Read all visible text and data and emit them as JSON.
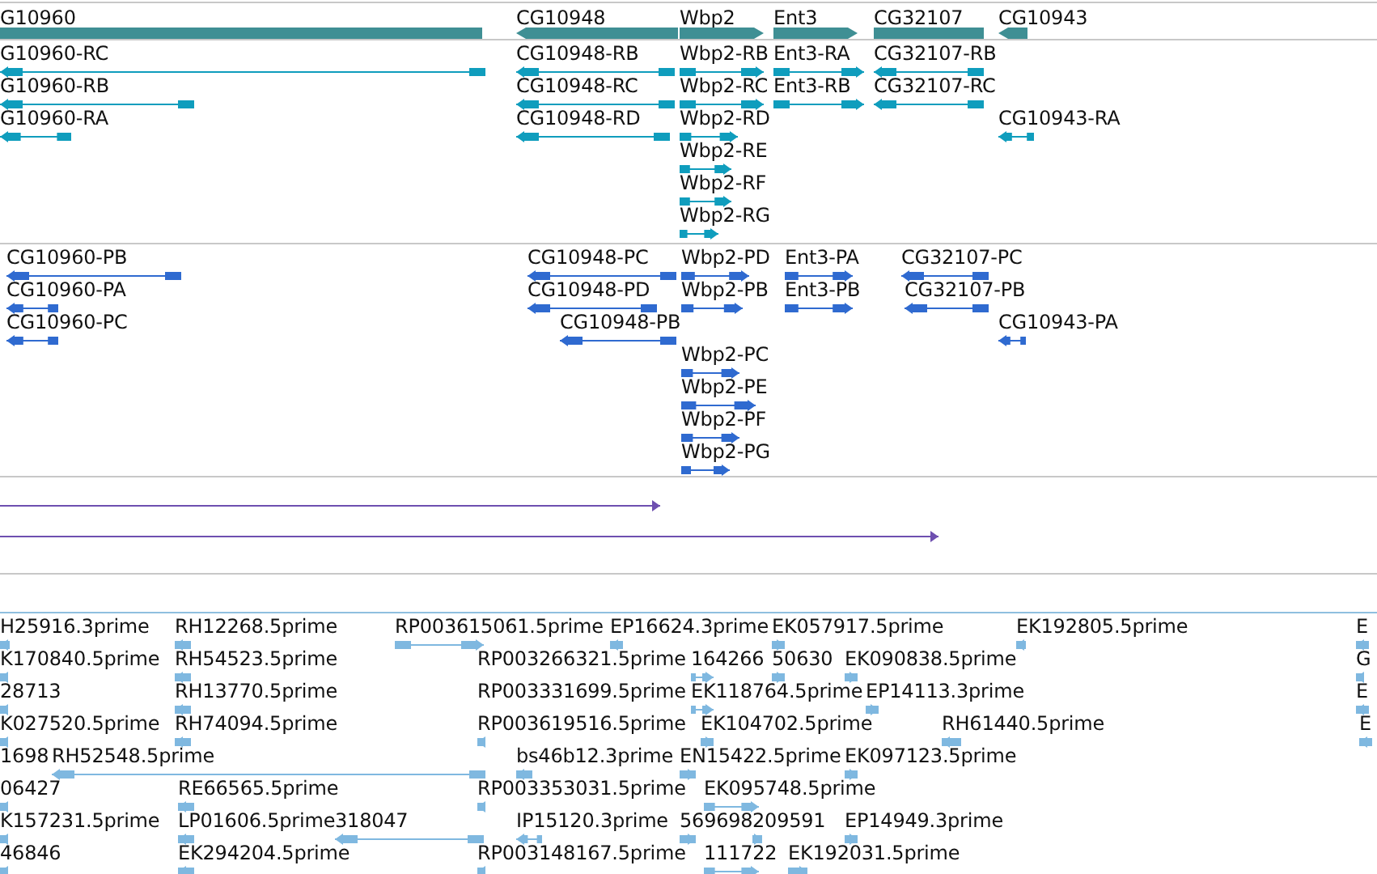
{
  "tracks": [
    {
      "kind": "gene",
      "color": "#3f8f94",
      "features": [
        {
          "label": "G10960",
          "kind": "plain"
        },
        {
          "label": "CG10948",
          "kind": "reverse"
        },
        {
          "label": "Wbp2",
          "kind": "forward"
        },
        {
          "label": "Ent3",
          "kind": "forward"
        },
        {
          "label": "CG32107",
          "kind": "plain"
        },
        {
          "label": "CG10943",
          "kind": "reverse"
        }
      ]
    },
    {
      "kind": "transcript",
      "color": "#0f9dbd",
      "features": [
        {
          "label": "G10960-RC",
          "kind": "reverse"
        },
        {
          "label": "CG10948-RB",
          "kind": "reverse"
        },
        {
          "label": "Wbp2-RB",
          "kind": "forward"
        },
        {
          "label": "Ent3-RA",
          "kind": "forward"
        },
        {
          "label": "CG32107-RB",
          "kind": "reverse"
        },
        {
          "label": "G10960-RB",
          "kind": "reverse"
        },
        {
          "label": "CG10948-RC",
          "kind": "reverse"
        },
        {
          "label": "Wbp2-RC",
          "kind": "forward"
        },
        {
          "label": "Ent3-RB",
          "kind": "forward"
        },
        {
          "label": "CG32107-RC",
          "kind": "reverse"
        },
        {
          "label": "G10960-RA",
          "kind": "reverse"
        },
        {
          "label": "CG10948-RD",
          "kind": "reverse"
        },
        {
          "label": "Wbp2-RD",
          "kind": "forward"
        },
        {
          "label": "CG10943-RA",
          "kind": "reverse"
        },
        {
          "label": "Wbp2-RE",
          "kind": "forward"
        },
        {
          "label": "Wbp2-RF",
          "kind": "forward"
        },
        {
          "label": "Wbp2-RG",
          "kind": "forward"
        }
      ]
    },
    {
      "kind": "transcript",
      "color": "#2f6ad0",
      "features": [
        {
          "label": "CG10960-PB",
          "kind": "reverse"
        },
        {
          "label": "CG10948-PC",
          "kind": "reverse"
        },
        {
          "label": "Wbp2-PD",
          "kind": "forward"
        },
        {
          "label": "Ent3-PA",
          "kind": "forward"
        },
        {
          "label": "CG32107-PC",
          "kind": "reverse"
        },
        {
          "label": "CG10960-PA",
          "kind": "reverse"
        },
        {
          "label": "CG10948-PD",
          "kind": "reverse"
        },
        {
          "label": "Wbp2-PB",
          "kind": "forward"
        },
        {
          "label": "Ent3-PB",
          "kind": "forward"
        },
        {
          "label": "CG32107-PB",
          "kind": "reverse"
        },
        {
          "label": "CG10960-PC",
          "kind": "reverse"
        },
        {
          "label": "CG10948-PB",
          "kind": "reverse"
        },
        {
          "label": "CG10943-PA",
          "kind": "reverse"
        },
        {
          "label": "Wbp2-PC",
          "kind": "forward"
        },
        {
          "label": "Wbp2-PE",
          "kind": "forward"
        },
        {
          "label": "Wbp2-PF",
          "kind": "forward"
        },
        {
          "label": "Wbp2-PG",
          "kind": "forward"
        }
      ]
    },
    {
      "kind": "alignment",
      "color": "#6e4fb0",
      "features": [
        {
          "kind": "forward"
        },
        {
          "kind": "forward"
        }
      ]
    },
    {
      "kind": "read",
      "color": "#7fb8e0",
      "features": [
        {
          "label": "H25916.3prime",
          "kind": "reverse"
        },
        {
          "label": "RH12268.5prime",
          "kind": "reverse"
        },
        {
          "label": "RP003615061.5prime",
          "kind": "forward"
        },
        {
          "label": "EP16624.3prime",
          "kind": "reverse"
        },
        {
          "label": "EK057917.5prime",
          "kind": "forward"
        },
        {
          "label": "EK192805.5prime",
          "kind": "reverse"
        },
        {
          "label": "E",
          "kind": "reverse"
        },
        {
          "label": "K170840.5prime",
          "kind": "reverse"
        },
        {
          "label": "RH54523.5prime",
          "kind": "reverse"
        },
        {
          "label": "RP003266321.5prime",
          "kind": "plain"
        },
        {
          "label": "164266",
          "kind": "forward"
        },
        {
          "label": "50630",
          "kind": "forward"
        },
        {
          "label": "EK090838.5prime",
          "kind": "forward"
        },
        {
          "label": "G",
          "kind": "reverse"
        },
        {
          "label": "28713",
          "kind": "reverse"
        },
        {
          "label": "RH13770.5prime",
          "kind": "reverse"
        },
        {
          "label": "RP003331699.5prime",
          "kind": "plain"
        },
        {
          "label": "EK118764.5prime",
          "kind": "forward"
        },
        {
          "label": "EP14113.3prime",
          "kind": "forward"
        },
        {
          "label": "E",
          "kind": "reverse"
        },
        {
          "label": "K027520.5prime",
          "kind": "reverse"
        },
        {
          "label": "RH74094.5prime",
          "kind": "reverse"
        },
        {
          "label": "RP003619516.5prime",
          "kind": "reverse"
        },
        {
          "label": "EK104702.5prime",
          "kind": "forward"
        },
        {
          "label": "RH61440.5prime",
          "kind": "reverse"
        },
        {
          "label": "E",
          "kind": "reverse"
        },
        {
          "label": "1698",
          "kind": "plain"
        },
        {
          "label": "RH52548.5prime",
          "kind": "reverse"
        },
        {
          "label": "bs46b12.3prime",
          "kind": "reverse"
        },
        {
          "label": "EN15422.5prime",
          "kind": "forward"
        },
        {
          "label": "EK097123.5prime",
          "kind": "forward"
        },
        {
          "label": "06427",
          "kind": "reverse"
        },
        {
          "label": "RE66565.5prime",
          "kind": "reverse"
        },
        {
          "label": "RP003353031.5prime",
          "kind": "reverse"
        },
        {
          "label": "EK095748.5prime",
          "kind": "forward"
        },
        {
          "label": "K157231.5prime",
          "kind": "reverse"
        },
        {
          "label": "LP01606.5prime",
          "kind": "reverse"
        },
        {
          "label": "318047",
          "kind": "reverse"
        },
        {
          "label": "IP15120.3prime",
          "kind": "reverse"
        },
        {
          "label": "569698",
          "kind": "forward"
        },
        {
          "label": "209591",
          "kind": "forward"
        },
        {
          "label": "EP14949.3prime",
          "kind": "forward"
        },
        {
          "label": "46846",
          "kind": "reverse"
        },
        {
          "label": "EK294204.5prime",
          "kind": "reverse"
        },
        {
          "label": "RP003148167.5prime",
          "kind": "reverse"
        },
        {
          "label": "111722",
          "kind": "forward"
        },
        {
          "label": "EK192031.5prime",
          "kind": "forward"
        }
      ]
    }
  ]
}
